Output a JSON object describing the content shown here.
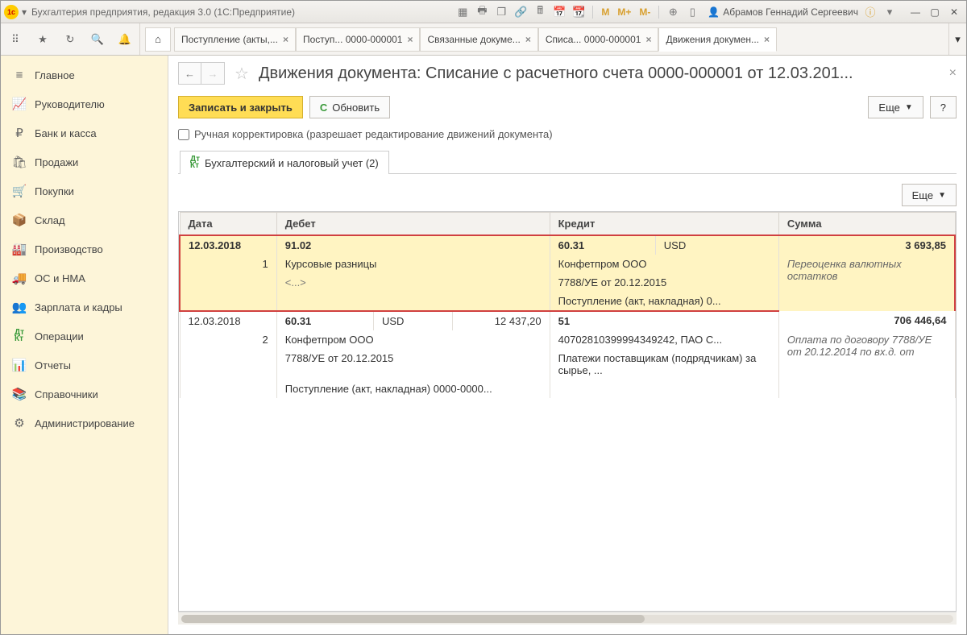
{
  "titlebar": {
    "app_title": "Бухгалтерия предприятия, редакция 3.0  (1С:Предприятие)",
    "m1": "M",
    "m2": "M+",
    "m3": "M-",
    "user": "Абрамов Геннадий Сергеевич"
  },
  "tabs": [
    {
      "label": "Поступление (акты,..."
    },
    {
      "label": "Поступ... 0000-000001"
    },
    {
      "label": "Связанные докуме..."
    },
    {
      "label": "Списа... 0000-000001"
    },
    {
      "label": "Движения докумен..."
    }
  ],
  "sidebar": [
    {
      "icon": "≡",
      "label": "Главное"
    },
    {
      "icon": "📈",
      "label": "Руководителю"
    },
    {
      "icon": "₽",
      "label": "Банк и касса"
    },
    {
      "icon": "🛍",
      "label": "Продажи"
    },
    {
      "icon": "🛒",
      "label": "Покупки"
    },
    {
      "icon": "📦",
      "label": "Склад"
    },
    {
      "icon": "🏭",
      "label": "Производство"
    },
    {
      "icon": "🚚",
      "label": "ОС и НМА"
    },
    {
      "icon": "👥",
      "label": "Зарплата и кадры"
    },
    {
      "icon": "Дт",
      "label": "Операции"
    },
    {
      "icon": "📊",
      "label": "Отчеты"
    },
    {
      "icon": "📚",
      "label": "Справочники"
    },
    {
      "icon": "⚙",
      "label": "Администрирование"
    }
  ],
  "content": {
    "title": "Движения документа: Списание с расчетного счета 0000-000001 от 12.03.201...",
    "save_close": "Записать и закрыть",
    "refresh": "Обновить",
    "more": "Еще",
    "help": "?",
    "manual_edit": "Ручная корректировка (разрешает редактирование движений документа)",
    "subtab": "Бухгалтерский и налоговый учет (2)",
    "cols": {
      "date": "Дата",
      "debit": "Дебет",
      "credit": "Кредит",
      "sum": "Сумма"
    },
    "row1": {
      "date": "12.03.2018",
      "n": "1",
      "debit_acc": "91.02",
      "debit_l2": "Курсовые разницы",
      "debit_l3": "<...>",
      "credit_acc": "60.31",
      "credit_curr": "USD",
      "credit_l2": "Конфетпром ООО",
      "credit_l3": "7788/УЕ от 20.12.2015",
      "credit_l4": "Поступление (акт, накладная) 0...",
      "sum": "3 693,85",
      "sum_l2": "Переоценка валютных остатков"
    },
    "row2": {
      "date": "12.03.2018",
      "n": "2",
      "debit_acc": "60.31",
      "debit_curr": "USD",
      "debit_amt": "12 437,20",
      "debit_l2": "Конфетпром ООО",
      "debit_l3": "7788/УЕ от 20.12.2015",
      "debit_l4": "Поступление (акт, накладная) 0000-0000...",
      "credit_acc": "51",
      "credit_l2": "40702810399994349242, ПАО С...",
      "credit_l3": "Платежи поставщикам (подрядчикам) за сырье, ...",
      "sum": "706 446,64",
      "sum_l2": "Оплата по договору 7788/УЕ от 20.12.2014 по вх.д.  от"
    }
  }
}
